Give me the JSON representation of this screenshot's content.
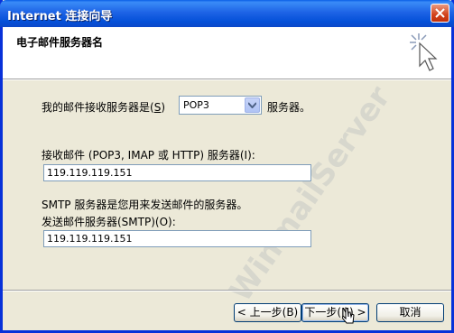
{
  "window": {
    "title": "Internet 连接向导"
  },
  "header": {
    "title": "电子邮件服务器名"
  },
  "form": {
    "server_type_label": "我的邮件接收服务器是",
    "server_type_accel": "(S)",
    "server_type_value": "POP3",
    "server_type_suffix": "服务器。",
    "incoming_label": "接收邮件 (POP3, IMAP 或 HTTP) 服务器(I):",
    "incoming_value": "119.119.119.151",
    "smtp_desc": "SMTP 服务器是您用来发送邮件的服务器。",
    "outgoing_label": "发送邮件服务器(SMTP)(O):",
    "outgoing_value": "119.119.119.151"
  },
  "buttons": {
    "back": "< 上一步(B)",
    "next": "下一步(N) >",
    "cancel": "取消"
  },
  "watermark": "WinmailServer",
  "colors": {
    "titlebar": "#0a5fe7",
    "dialog_bg": "#ece9d8",
    "field_border": "#7f9db9"
  }
}
